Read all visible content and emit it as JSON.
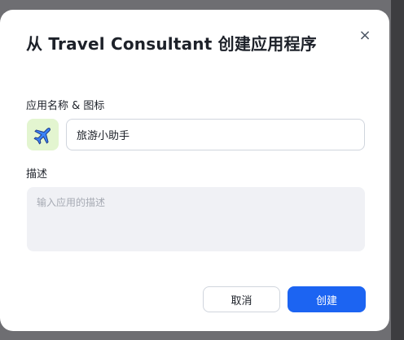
{
  "dialog": {
    "title": "从 Travel Consultant 创建应用程序",
    "close_icon": "close-icon",
    "close_glyph": "×"
  },
  "form": {
    "name_label": "应用名称 & 图标",
    "app_icon": "airplane-icon",
    "app_icon_bg": "#e3f5d0",
    "name_value": "旅游小助手",
    "desc_label": "描述",
    "desc_placeholder": "输入应用的描述",
    "desc_value": ""
  },
  "actions": {
    "cancel_label": "取消",
    "create_label": "创建",
    "accent_color": "#1c64f2"
  }
}
